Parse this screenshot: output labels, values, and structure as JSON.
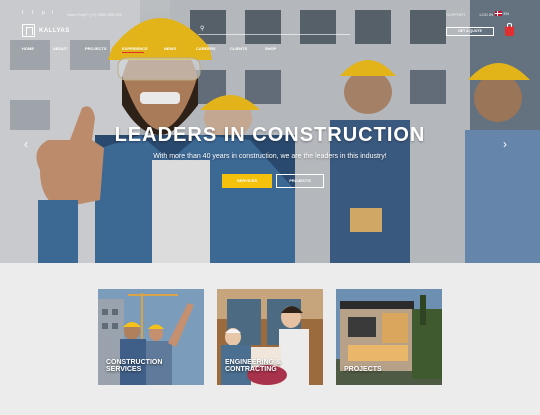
{
  "topbar": {
    "social": [
      "f",
      "t",
      "p",
      "i"
    ],
    "contact": "Need Help? (+1) 0000 000 000",
    "links": [
      "SUPPORT",
      "LOG IN"
    ],
    "lang": "EN"
  },
  "logo": {
    "text": "KALLYAS"
  },
  "header": {
    "quote_label": "GET A QUOTE"
  },
  "nav": {
    "items": [
      "HOME",
      "ABOUT",
      "PROJECTS",
      "EXPERIENCE",
      "NEWS",
      "CAREERS",
      "CLIENTS",
      "SHOP"
    ]
  },
  "hero": {
    "title": "LEADERS IN CONSTRUCTION",
    "subtitle": "With more than 40 years in construction, we are the leaders in this industry!",
    "btn_services": "SERVICES",
    "btn_projects": "PROJECTS"
  },
  "cards": [
    {
      "line1": "CONSTRUCTION",
      "line2": "SERVICES"
    },
    {
      "line1": "ENGINEERING &",
      "line2": "CONTRACTING"
    },
    {
      "line1": "PROJECTS",
      "line2": ""
    }
  ],
  "colors": {
    "accent_red": "#e12f2f",
    "accent_yellow": "#f4c20d"
  }
}
